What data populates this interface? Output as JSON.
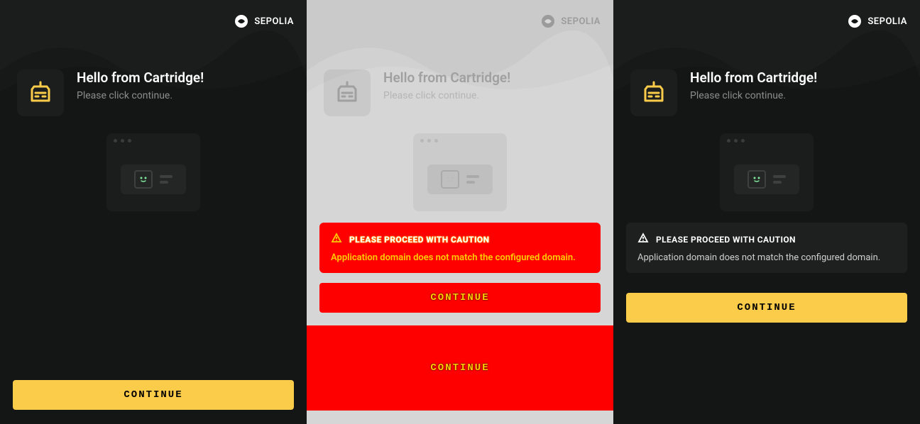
{
  "network": {
    "label": "SEPOLIA"
  },
  "header": {
    "title": "Hello from Cartridge!",
    "subtitle": "Please click continue."
  },
  "warning": {
    "title": "PLEASE PROCEED WITH CAUTION",
    "message": "Application domain does not match the configured domain."
  },
  "buttons": {
    "continue": "CONTINUE"
  },
  "colors": {
    "accent": "#fbcb4a",
    "danger": "#ff0000",
    "dangerText": "#ffcc00"
  }
}
